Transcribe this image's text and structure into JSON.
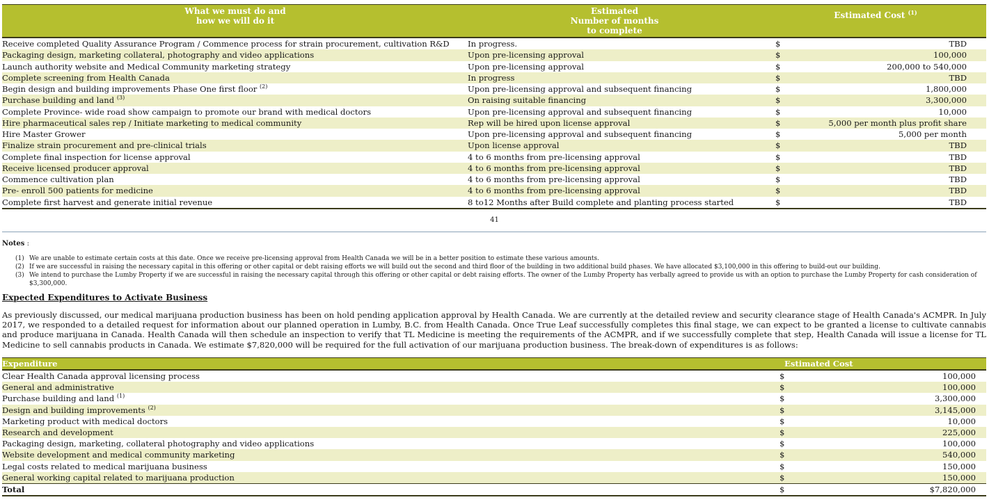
{
  "milestones": {
    "headers": {
      "task": "What we must do and\nhow we will do it",
      "months": "Estimated\nNumber of months\nto complete",
      "cost": "Estimated Cost",
      "cost_note": "(1)"
    },
    "rows": [
      {
        "task": "Receive completed Quality Assurance Program / Commence process for strain procurement, cultivation R&D",
        "note": "",
        "months": "In progress.",
        "currency": "$",
        "cost": "TBD"
      },
      {
        "task": "Packaging design, marketing collateral, photography and video applications",
        "note": "",
        "months": "Upon pre-licensing approval",
        "currency": "$",
        "cost": "100,000"
      },
      {
        "task": "Launch authority website and Medical Community marketing strategy",
        "note": "",
        "months": "Upon pre-licensing approval",
        "currency": "$",
        "cost": "200,000 to 540,000"
      },
      {
        "task": "Complete screening from Health Canada",
        "note": "",
        "months": "In progress",
        "currency": "$",
        "cost": "TBD"
      },
      {
        "task": "Begin design and building improvements Phase One first floor",
        "note": "(2)",
        "months": "Upon pre-licensing approval and subsequent financing",
        "currency": "$",
        "cost": "1,800,000"
      },
      {
        "task": "Purchase building and land",
        "note": "(3)",
        "months": "On raising suitable financing",
        "currency": "$",
        "cost": "3,300,000"
      },
      {
        "task": "Complete Province- wide road show campaign to promote our brand with medical doctors",
        "note": "",
        "months": "Upon pre-licensing approval and subsequent financing",
        "currency": "$",
        "cost": "10,000"
      },
      {
        "task": "Hire pharmaceutical sales rep / Initiate marketing to medical community",
        "note": "",
        "months": "Rep will be hired upon license approval",
        "currency": "$",
        "cost": "5,000 per month plus profit share"
      },
      {
        "task": "Hire Master Grower",
        "note": "",
        "months": "Upon pre-licensing approval and subsequent financing",
        "currency": "$",
        "cost": "5,000 per month"
      },
      {
        "task": "Finalize strain procurement and pre-clinical trials",
        "note": "",
        "months": "Upon license approval",
        "currency": "$",
        "cost": "TBD"
      },
      {
        "task": "Complete final inspection for license approval",
        "note": "",
        "months": "4 to 6 months from pre-licensing approval",
        "currency": "$",
        "cost": "TBD"
      },
      {
        "task": "Receive licensed producer approval",
        "note": "",
        "months": "4 to 6 months from pre-licensing approval",
        "currency": "$",
        "cost": "TBD"
      },
      {
        "task": "Commence cultivation plan",
        "note": "",
        "months": "4 to 6 months from pre-licensing approval",
        "currency": "$",
        "cost": "TBD"
      },
      {
        "task": "Pre- enroll 500 patients for medicine",
        "note": "",
        "months": "4 to 6 months from pre-licensing approval",
        "currency": "$",
        "cost": "TBD"
      },
      {
        "task": "Complete first harvest and generate initial revenue",
        "note": "",
        "months": "8 to12 Months after Build complete and planting process started",
        "currency": "$",
        "cost": "TBD"
      }
    ]
  },
  "page_number": "41",
  "notes": {
    "title": "Notes",
    "colon": " :",
    "items": [
      {
        "num": "(1)",
        "text": "We are unable to estimate certain costs at this date. Once we receive pre-licensing approval from Health Canada we will be in a better position to estimate these various amounts."
      },
      {
        "num": "(2)",
        "text": "If we are successful in raising the necessary capital in this offering or other capital or debt raising efforts we will build out the second and third floor of the building in two additional build phases. We have allocated $3,100,000 in this offering to build-out our building."
      },
      {
        "num": "(3)",
        "text": "We intend to purchase the Lumby Property if we are successful in raising the necessary capital through this offering or other capital or debt raising efforts. The owner of the Lumby Property has verbally agreed to provide us with an option to purchase the Lumby Property for cash consideration of $3,300,000."
      }
    ]
  },
  "expenditures_section": {
    "title": "Expected Expenditures to Activate Business",
    "paragraph": "As previously discussed, our medical marijuana production business has been on hold pending application approval by Health Canada. We are currently at the detailed review and security clearance stage of Health Canada's ACMPR. In July 2017, we responded to a detailed request for information about our planned operation in Lumby, B.C. from Health Canada. Once True Leaf successfully completes this final stage, we can expect to be granted a license to cultivate cannabis and produce marijuana in Canada. Health Canada will then schedule an inspection to verify that TL Medicine is meeting the requirements of the ACMPR, and if we successfully complete that step, Health Canada will issue a license for TL Medicine to sell cannabis products in Canada. We estimate $7,820,000 will be required for the full activation of our marijuana production business. The break-down of expenditures is as follows:"
  },
  "expenditures": {
    "headers": {
      "item": "Expenditure",
      "cost": "Estimated Cost"
    },
    "rows": [
      {
        "item": "Clear Health Canada approval licensing process",
        "note": "",
        "currency": "$",
        "cost": "100,000"
      },
      {
        "item": "General and administrative",
        "note": "",
        "currency": "$",
        "cost": "100,000"
      },
      {
        "item": "Purchase building and land",
        "note": "(1)",
        "currency": "$",
        "cost": "3,300,000"
      },
      {
        "item": "Design and building improvements",
        "note": "(2)",
        "currency": "$",
        "cost": "3,145,000"
      },
      {
        "item": "Marketing product with medical doctors",
        "note": "",
        "currency": "$",
        "cost": "10,000"
      },
      {
        "item": "Research and development",
        "note": "",
        "currency": "$",
        "cost": "225,000"
      },
      {
        "item": "Packaging design, marketing, collateral photography and video applications",
        "note": "",
        "currency": "$",
        "cost": "100,000"
      },
      {
        "item": "Website development and medical community marketing",
        "note": "",
        "currency": "$",
        "cost": "540,000"
      },
      {
        "item": "Legal costs related to medical marijuana business",
        "note": "",
        "currency": "$",
        "cost": "150,000"
      },
      {
        "item": "General working capital related to marijuana production",
        "note": "",
        "currency": "$",
        "cost": "150,000"
      }
    ],
    "total": {
      "label": "Total",
      "currency": "$",
      "cost": "$7,820,000"
    }
  }
}
